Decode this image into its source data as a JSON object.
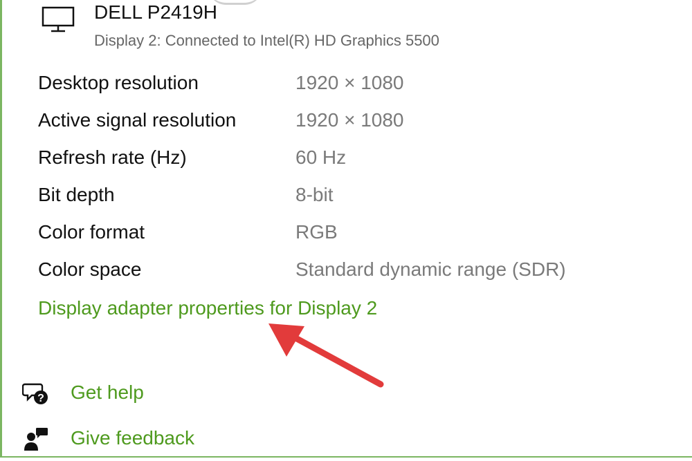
{
  "monitor": {
    "icon": "monitor-icon",
    "name": "DELL P2419H",
    "subtitle": "Display 2: Connected to Intel(R) HD Graphics 5500"
  },
  "properties": [
    {
      "label": "Desktop resolution",
      "value": "1920 × 1080"
    },
    {
      "label": "Active signal resolution",
      "value": "1920 × 1080"
    },
    {
      "label": "Refresh rate (Hz)",
      "value": "60 Hz"
    },
    {
      "label": "Bit depth",
      "value": "8-bit"
    },
    {
      "label": "Color format",
      "value": "RGB"
    },
    {
      "label": "Color space",
      "value": "Standard dynamic range (SDR)"
    }
  ],
  "adapter_link": {
    "label": "Display adapter properties for Display 2"
  },
  "annotation": {
    "icon": "red-arrow-icon",
    "color": "#e23b3b"
  },
  "help": {
    "label": "Get help",
    "icon": "help-chat-icon"
  },
  "feedback": {
    "label": "Give feedback",
    "icon": "feedback-person-icon"
  },
  "colors": {
    "link": "#4e9a1e",
    "frame": "#7bb661",
    "value_text": "#7a7a7a"
  }
}
